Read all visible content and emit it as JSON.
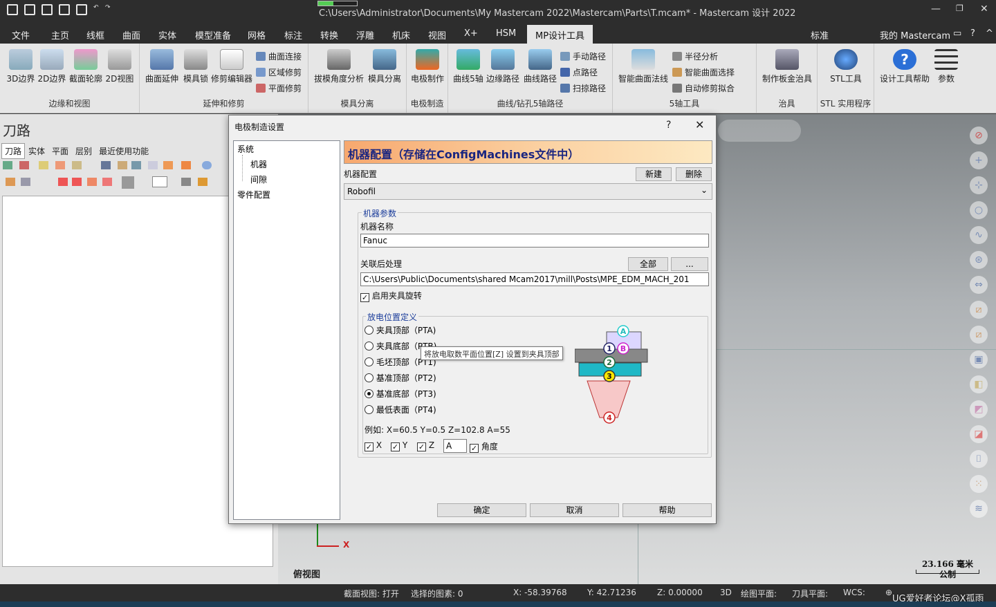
{
  "titlebar": {
    "title": "C:\\Users\\Administrator\\Documents\\My Mastercam 2022\\Mastercam\\Parts\\T.mcam* - Mastercam 设计 2022"
  },
  "menubar": {
    "tabs": [
      "文件",
      "主页",
      "线框",
      "曲面",
      "实体",
      "模型准备",
      "网格",
      "标注",
      "转换",
      "浮雕",
      "机床",
      "视图",
      "X+",
      "HSM",
      "MP设计工具"
    ],
    "active": "MP设计工具",
    "standard": "标准",
    "my_mastercam": "我的 Mastercam"
  },
  "ribbon": {
    "groups": [
      {
        "label": "边缘和视图",
        "buttons": [
          "3D边界",
          "2D边界",
          "截面轮廓",
          "2D视图"
        ]
      },
      {
        "label": "延伸和修剪",
        "buttons": [
          "曲面延伸",
          "模具锁",
          "修剪编辑器"
        ],
        "small": [
          "曲面连接",
          "区域修剪",
          "平面修剪"
        ]
      },
      {
        "label": "模具分离",
        "buttons": [
          "拔模角度分析",
          "模具分离"
        ]
      },
      {
        "label": "电极制造",
        "buttons": [
          "电极制作"
        ]
      },
      {
        "label": "曲线/钻孔5轴路径",
        "buttons": [
          "曲线5轴",
          "边缘路径",
          "曲线路径"
        ],
        "small": [
          "手动路径",
          "点路径",
          "扫掠路径"
        ]
      },
      {
        "label": "5轴工具",
        "buttons": [
          "智能曲面法线"
        ],
        "small": [
          "半径分析",
          "智能曲面选择",
          "自动修剪拟合"
        ]
      },
      {
        "label": "治具",
        "buttons": [
          "制作板金治具"
        ]
      },
      {
        "label": "STL 实用程序",
        "buttons": [
          "STL工具"
        ]
      },
      {
        "label": "",
        "buttons": [
          "设计工具帮助",
          "参数"
        ]
      }
    ]
  },
  "leftpanel": {
    "title": "刀路",
    "tabs": [
      "刀路",
      "实体",
      "平面",
      "层别",
      "最近使用功能"
    ]
  },
  "viewport": {
    "view_label": "俯视图",
    "axis_x": "X",
    "scale_value": "23.166 毫米",
    "scale_unit": "公制"
  },
  "statusbar": {
    "section_view": "截面视图: 打开",
    "selected": "选择的图素: 0",
    "x": "X:  -58.39768",
    "y": "Y:  42.71236",
    "z": "Z:  0.00000",
    "mode": "3D",
    "draw_plane": "绘图平面:",
    "tool_plane": "刀具平面:",
    "wcs": "WCS:"
  },
  "watermark": "UG爱好者论坛@X孤雨",
  "dialog": {
    "title": "电极制造设置",
    "help": "?",
    "close": "✕",
    "tree": {
      "system": "系统",
      "machine": "机器",
      "gap": "间隙",
      "part_config": "零件配置"
    },
    "banner": "机器配置（存储在ConfigMachines文件中）",
    "machine_config_label": "机器配置",
    "new_btn": "新建",
    "delete_btn": "删除",
    "machine_select": "Robofil",
    "params_group": "机器参数",
    "machine_name_label": "机器名称",
    "machine_name": "Fanuc",
    "post_label": "关联后处理",
    "all_btn": "全部",
    "browse_btn": "...",
    "post_path": "C:\\Users\\Public\\Documents\\shared Mcam2017\\mill\\Posts\\MPE_EDM_MACH_201",
    "enable_rotation": "启用夹具旋转",
    "discharge_group": "放电位置定义",
    "options": [
      "夹具顶部（PTA)",
      "夹具底部（PTB)",
      "毛坯顶部（PT1)",
      "基准顶部（PT2)",
      "基准底部（PT3)",
      "最低表面（PT4)"
    ],
    "selected_option": 4,
    "example": "例如: X=60.5  Y=0.5  Z=102.8  A=55",
    "chk_x": "X",
    "chk_y": "Y",
    "chk_z": "Z",
    "angle_value": "A",
    "chk_angle": "角度",
    "tooltip": "将放电取数平面位置[Z] 设置到夹具顶部",
    "diagram_markers": [
      "A",
      "B",
      "1",
      "2",
      "3",
      "4"
    ],
    "ok": "确定",
    "cancel": "取消",
    "help_btn": "帮助"
  }
}
